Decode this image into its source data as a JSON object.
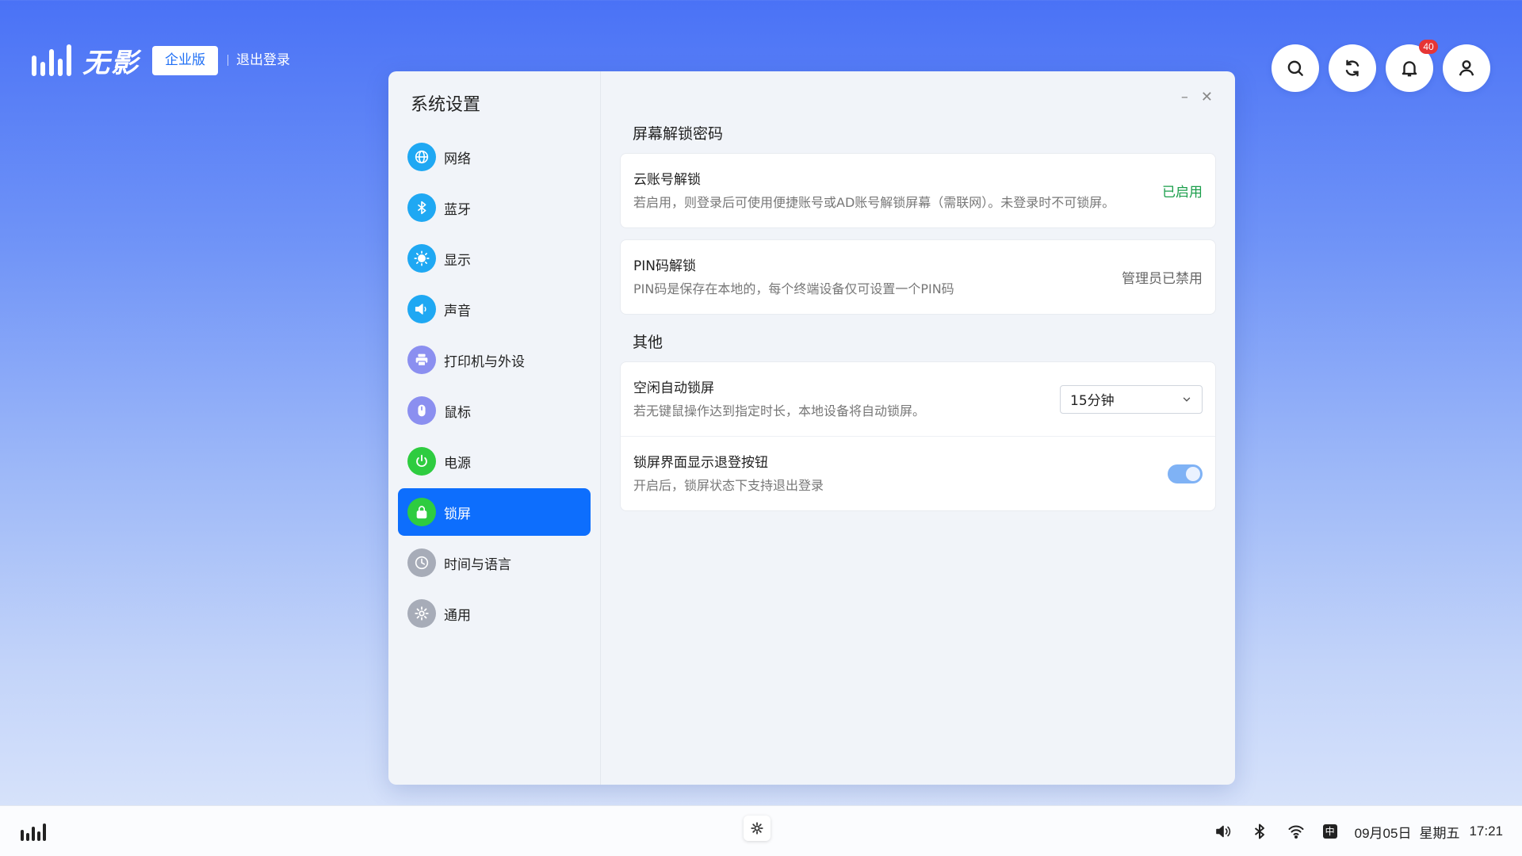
{
  "brand": {
    "name": "无影",
    "edition": "企业版",
    "logout": "退出登录"
  },
  "topbar": {
    "notification_count": "40"
  },
  "settings": {
    "title": "系统设置",
    "nav": [
      {
        "label": "网络",
        "icon": "globe-icon",
        "color": "#1fa8f3"
      },
      {
        "label": "蓝牙",
        "icon": "bluetooth-icon",
        "color": "#1fa8f3"
      },
      {
        "label": "显示",
        "icon": "sun-icon",
        "color": "#1fa8f3"
      },
      {
        "label": "声音",
        "icon": "speaker-icon",
        "color": "#1fa8f3"
      },
      {
        "label": "打印机与外设",
        "icon": "printer-icon",
        "color": "#8b8ff0"
      },
      {
        "label": "鼠标",
        "icon": "mouse-icon",
        "color": "#8b8ff0"
      },
      {
        "label": "电源",
        "icon": "power-icon",
        "color": "#2ecc40"
      },
      {
        "label": "锁屏",
        "icon": "lock-icon",
        "color": "#2ecc40"
      },
      {
        "label": "时间与语言",
        "icon": "clock-icon",
        "color": "#a7acb8"
      },
      {
        "label": "通用",
        "icon": "gear-icon",
        "color": "#a7acb8"
      }
    ],
    "active_index": 7,
    "window_controls": {
      "minimize": "–",
      "close": "✕"
    },
    "unlock_section": {
      "title": "屏幕解锁密码",
      "cloud": {
        "title": "云账号解锁",
        "desc": "若启用，则登录后可使用便捷账号或AD账号解锁屏幕（需联网）。未登录时不可锁屏。",
        "status": "已启用"
      },
      "pin": {
        "title": "PIN码解锁",
        "desc": "PIN码是保存在本地的，每个终端设备仅可设置一个PIN码",
        "status": "管理员已禁用"
      }
    },
    "other_section": {
      "title": "其他",
      "idle": {
        "title": "空闲自动锁屏",
        "desc": "若无键鼠操作达到指定时长，本地设备将自动锁屏。",
        "value": "15分钟"
      },
      "logout_button": {
        "title": "锁屏界面显示退登按钮",
        "desc": "开启后，锁屏状态下支持退出登录",
        "enabled": true
      }
    }
  },
  "taskbar": {
    "ime": "中",
    "date": "09月05日",
    "weekday": "星期五",
    "time": "17:21"
  }
}
